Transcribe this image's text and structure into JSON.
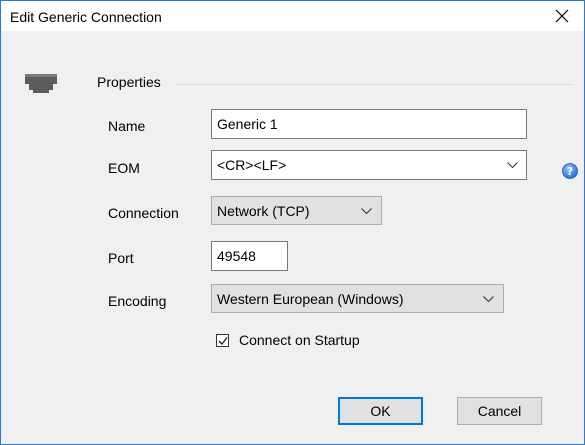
{
  "dialog": {
    "title": "Edit Generic Connection",
    "section_label": "Properties"
  },
  "fields": {
    "name_label": "Name",
    "name_value": "Generic 1",
    "eom_label": "EOM",
    "eom_value": "<CR><LF>",
    "connection_label": "Connection",
    "connection_value": "Network (TCP)",
    "port_label": "Port",
    "port_value": "49548",
    "encoding_label": "Encoding",
    "encoding_value": "Western European (Windows)"
  },
  "options": {
    "connect_on_startup_label": "Connect on Startup",
    "connect_on_startup_checked": true
  },
  "buttons": {
    "ok_label": "OK",
    "cancel_label": "Cancel"
  },
  "icons": {
    "section": "network-connector-icon",
    "help": "help-icon",
    "close": "close-icon",
    "dropdown": "chevron-down-icon"
  },
  "colors": {
    "window_border": "#2b79d0",
    "dialog_bg": "#f0f0f0",
    "default_button_border": "#0078d7",
    "help_blue": "#2f6fd6"
  }
}
